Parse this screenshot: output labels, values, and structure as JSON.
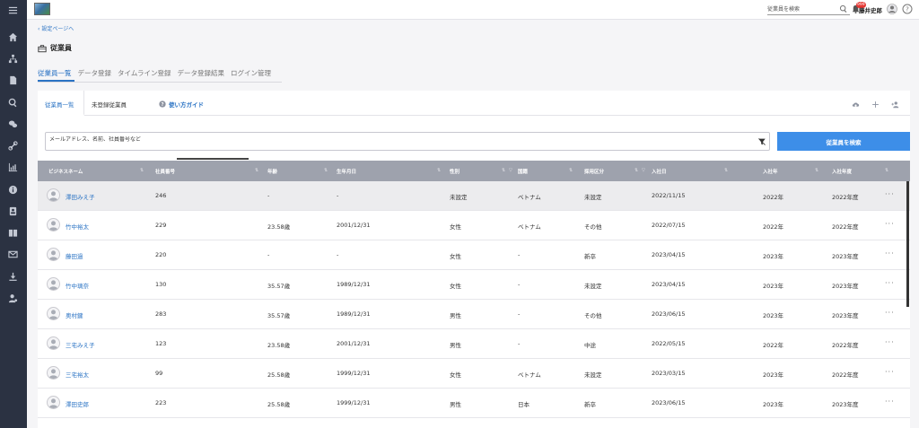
{
  "topbar": {
    "search_placeholder": "従業員を検索",
    "notification_badge": "999",
    "username": "藤井史郎"
  },
  "breadcrumb": {
    "back_label": "設定ページへ"
  },
  "page": {
    "title": "従業員"
  },
  "section_tabs": [
    {
      "label": "従業員一覧",
      "active": true
    },
    {
      "label": "データ登録",
      "active": false
    },
    {
      "label": "タイムライン登録",
      "active": false
    },
    {
      "label": "データ登録結果",
      "active": false
    },
    {
      "label": "ログイン管理",
      "active": false
    }
  ],
  "card_tabs": [
    {
      "label": "従業員一覧",
      "active": true
    },
    {
      "label": "未登録従業員",
      "active": false
    }
  ],
  "guide_label": "使い方ガイド",
  "filter": {
    "placeholder": "メールアドレス、名前、社員番号など",
    "search_button": "従業員を検索"
  },
  "table": {
    "columns": [
      "ビジネスネーム",
      "社員番号",
      "年齢",
      "生年月日",
      "性別",
      "国籍",
      "採用区分",
      "入社日",
      "入社年",
      "入社年度"
    ],
    "rows": [
      {
        "name": "澤田みえ子",
        "emp_no": "246",
        "age": "-",
        "birth": "-",
        "gender": "未設定",
        "nationality": "ベトナム",
        "hire_type": "未設定",
        "hire_date": "2022/11/15",
        "hire_year": "2022年",
        "fiscal_year": "2022年度"
      },
      {
        "name": "竹中裕太",
        "emp_no": "229",
        "age": "23.58歳",
        "birth": "2001/12/31",
        "gender": "女性",
        "nationality": "ベトナム",
        "hire_type": "その他",
        "hire_date": "2022/07/15",
        "hire_year": "2022年",
        "fiscal_year": "2022年度"
      },
      {
        "name": "藤田過",
        "emp_no": "220",
        "age": "-",
        "birth": "-",
        "gender": "女性",
        "nationality": "-",
        "hire_type": "新卒",
        "hire_date": "2023/04/15",
        "hire_year": "2023年",
        "fiscal_year": "2023年度"
      },
      {
        "name": "竹中璃奈",
        "emp_no": "130",
        "age": "35.57歳",
        "birth": "1989/12/31",
        "gender": "女性",
        "nationality": "-",
        "hire_type": "未設定",
        "hire_date": "2023/04/15",
        "hire_year": "2023年",
        "fiscal_year": "2023年度"
      },
      {
        "name": "奥村鍵",
        "emp_no": "283",
        "age": "35.57歳",
        "birth": "1989/12/31",
        "gender": "男性",
        "nationality": "-",
        "hire_type": "その他",
        "hire_date": "2023/06/15",
        "hire_year": "2023年",
        "fiscal_year": "2023年度"
      },
      {
        "name": "三宅みえ子",
        "emp_no": "123",
        "age": "23.58歳",
        "birth": "2001/12/31",
        "gender": "男性",
        "nationality": "-",
        "hire_type": "中途",
        "hire_date": "2022/05/15",
        "hire_year": "2022年",
        "fiscal_year": "2022年度"
      },
      {
        "name": "三宅裕太",
        "emp_no": "99",
        "age": "25.58歳",
        "birth": "1999/12/31",
        "gender": "女性",
        "nationality": "ベトナム",
        "hire_type": "未設定",
        "hire_date": "2023/03/15",
        "hire_year": "2023年",
        "fiscal_year": "2022年度"
      },
      {
        "name": "澤田史郎",
        "emp_no": "223",
        "age": "25.58歳",
        "birth": "1999/12/31",
        "gender": "男性",
        "nationality": "日本",
        "hire_type": "新卒",
        "hire_date": "2023/06/15",
        "hire_year": "2023年",
        "fiscal_year": "2023年度"
      }
    ]
  },
  "colors": {
    "accent": "#2a73c4",
    "button": "#3d8ee8",
    "sidebar": "#2b3242",
    "header": "#9ea2ad"
  }
}
